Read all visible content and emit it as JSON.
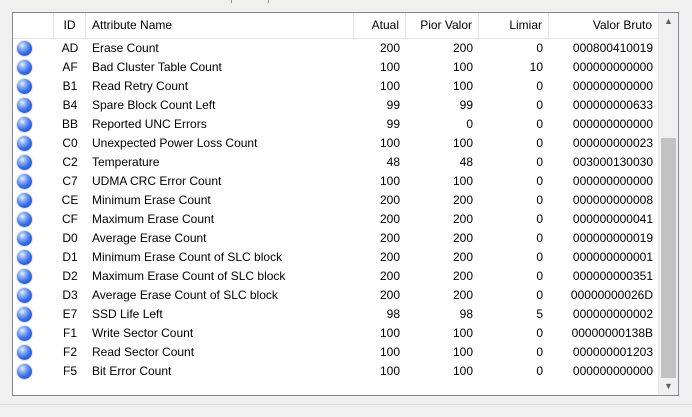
{
  "columns": {
    "id": "ID",
    "name": "Attribute Name",
    "current": "Atual",
    "worst": "Pior Valor",
    "threshold": "Limiar",
    "raw": "Valor Bruto"
  },
  "status_color": "#3b6fe6",
  "status_icon": "blue-ball-icon",
  "scroll_up_icon": "chevron-up-icon",
  "scroll_down_icon": "chevron-down-icon",
  "rows": [
    {
      "id": "AD",
      "name": "Erase Count",
      "current": "200",
      "worst": "200",
      "threshold": "0",
      "raw": "000800410019"
    },
    {
      "id": "AF",
      "name": "Bad Cluster Table Count",
      "current": "100",
      "worst": "100",
      "threshold": "10",
      "raw": "000000000000"
    },
    {
      "id": "B1",
      "name": "Read Retry Count",
      "current": "100",
      "worst": "100",
      "threshold": "0",
      "raw": "000000000000"
    },
    {
      "id": "B4",
      "name": "Spare Block Count Left",
      "current": "99",
      "worst": "99",
      "threshold": "0",
      "raw": "000000000633"
    },
    {
      "id": "BB",
      "name": "Reported UNC Errors",
      "current": "99",
      "worst": "0",
      "threshold": "0",
      "raw": "000000000000"
    },
    {
      "id": "C0",
      "name": "Unexpected Power Loss Count",
      "current": "100",
      "worst": "100",
      "threshold": "0",
      "raw": "000000000023"
    },
    {
      "id": "C2",
      "name": "Temperature",
      "current": "48",
      "worst": "48",
      "threshold": "0",
      "raw": "003000130030"
    },
    {
      "id": "C7",
      "name": "UDMA CRC Error Count",
      "current": "100",
      "worst": "100",
      "threshold": "0",
      "raw": "000000000000"
    },
    {
      "id": "CE",
      "name": "Minimum Erase Count",
      "current": "200",
      "worst": "200",
      "threshold": "0",
      "raw": "000000000008"
    },
    {
      "id": "CF",
      "name": "Maximum Erase Count",
      "current": "200",
      "worst": "200",
      "threshold": "0",
      "raw": "000000000041"
    },
    {
      "id": "D0",
      "name": "Average Erase Count",
      "current": "200",
      "worst": "200",
      "threshold": "0",
      "raw": "000000000019"
    },
    {
      "id": "D1",
      "name": "Minimum Erase Count of SLC block",
      "current": "200",
      "worst": "200",
      "threshold": "0",
      "raw": "000000000001"
    },
    {
      "id": "D2",
      "name": "Maximum Erase Count of SLC block",
      "current": "200",
      "worst": "200",
      "threshold": "0",
      "raw": "000000000351"
    },
    {
      "id": "D3",
      "name": "Average Erase Count of SLC block",
      "current": "200",
      "worst": "200",
      "threshold": "0",
      "raw": "00000000026D"
    },
    {
      "id": "E7",
      "name": "SSD Life Left",
      "current": "98",
      "worst": "98",
      "threshold": "5",
      "raw": "000000000002"
    },
    {
      "id": "F1",
      "name": "Write Sector Count",
      "current": "100",
      "worst": "100",
      "threshold": "0",
      "raw": "00000000138B"
    },
    {
      "id": "F2",
      "name": "Read Sector Count",
      "current": "100",
      "worst": "100",
      "threshold": "0",
      "raw": "000000001203"
    },
    {
      "id": "F5",
      "name": "Bit Error Count",
      "current": "100",
      "worst": "100",
      "threshold": "0",
      "raw": "000000000000"
    }
  ]
}
